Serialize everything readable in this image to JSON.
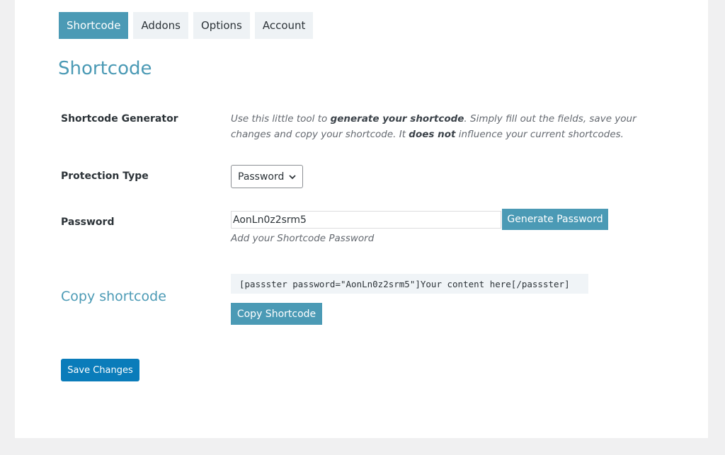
{
  "tabs": [
    {
      "label": "Shortcode",
      "active": true
    },
    {
      "label": "Addons",
      "active": false
    },
    {
      "label": "Options",
      "active": false
    },
    {
      "label": "Account",
      "active": false
    }
  ],
  "page_title": "Shortcode",
  "generator": {
    "label": "Shortcode Generator",
    "desc_1": "Use this little tool to ",
    "desc_bold_1": "generate your shortcode",
    "desc_2": ". Simply fill out the fields, save your changes and copy your shortcode. It ",
    "desc_bold_2": "does not",
    "desc_3": " influence your current shortcodes."
  },
  "protection": {
    "label": "Protection Type",
    "selected": "Password"
  },
  "password": {
    "label": "Password",
    "value": "AonLn0z2srm5",
    "generate_button": "Generate Password",
    "help": "Add your Shortcode Password"
  },
  "copy": {
    "label": "Copy shortcode",
    "code": "[passster password=\"AonLn0z2srm5\"]Your content here[/passster]",
    "button": "Copy Shortcode"
  },
  "save_button": "Save Changes",
  "colors": {
    "accent": "#4b9ab5",
    "save": "#0a7cba"
  }
}
